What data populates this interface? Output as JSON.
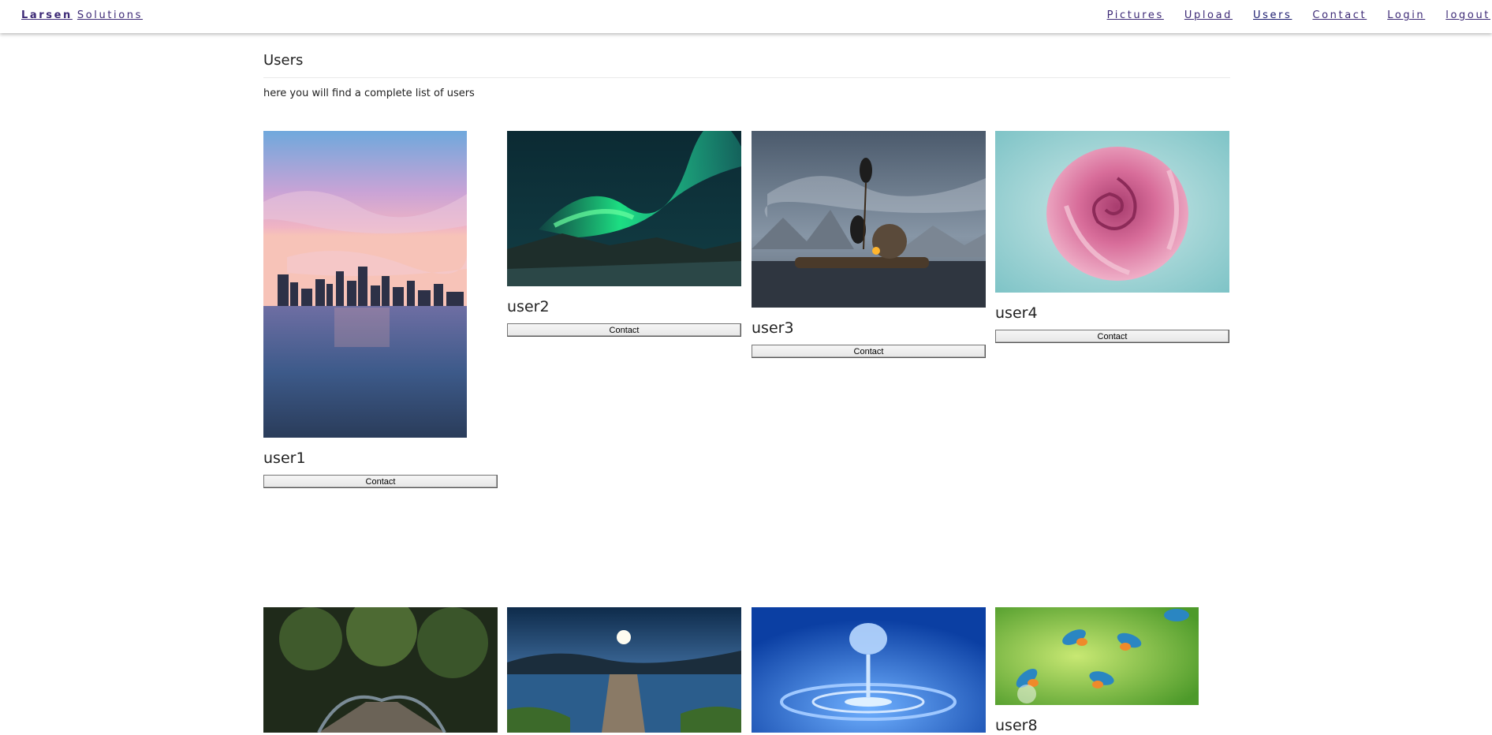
{
  "nav": {
    "brand_bold": "Larsen",
    "brand_rest": "Solutions",
    "links": [
      "Pictures",
      "Upload",
      "Users",
      "Contact",
      "Login",
      "logout"
    ]
  },
  "page": {
    "title": "Users",
    "intro": "here you will find a complete list of users"
  },
  "users": [
    {
      "name": "user1",
      "button": "Contact",
      "image": "city-skyline-sunset"
    },
    {
      "name": "user2",
      "button": "Contact",
      "image": "northern-lights"
    },
    {
      "name": "user3",
      "button": "Contact",
      "image": "fisherman-cormorants"
    },
    {
      "name": "user4",
      "button": "Contact",
      "image": "pink-rose"
    },
    {
      "name": "",
      "button": "",
      "image": "forest-bridge"
    },
    {
      "name": "",
      "button": "",
      "image": "moonlit-lake-dock"
    },
    {
      "name": "",
      "button": "",
      "image": "water-droplet"
    },
    {
      "name": "user8",
      "button": "",
      "image": "kingfishers"
    }
  ]
}
